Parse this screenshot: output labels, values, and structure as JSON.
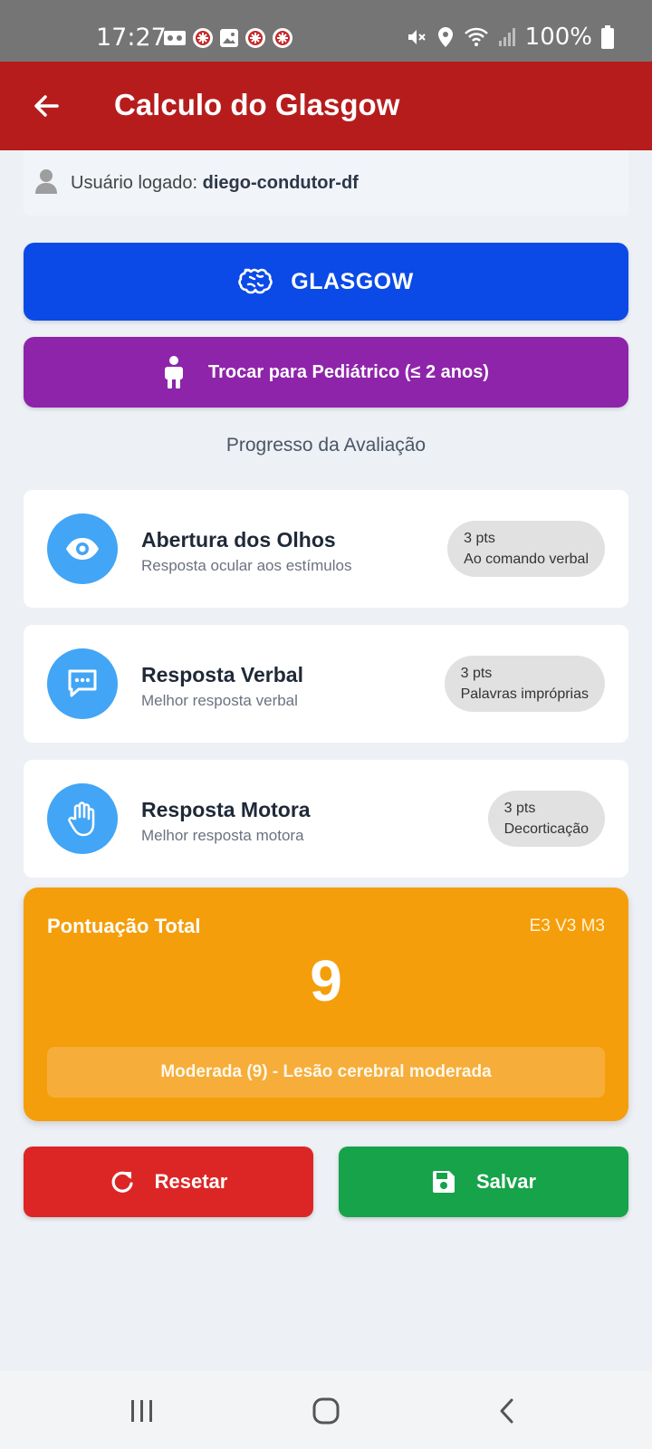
{
  "status_bar": {
    "time": "17:27",
    "battery": "100%",
    "left_icons": [
      "voicemail-icon",
      "app-notification-icon",
      "image-icon",
      "app-notification-icon",
      "app-notification-icon"
    ],
    "right_icons": [
      "mute-icon",
      "location-icon",
      "wifi-icon",
      "signal-icon",
      "battery-icon"
    ]
  },
  "app_bar": {
    "title": "Calculo do Glasgow",
    "color": "#b71c1c"
  },
  "user": {
    "prefix": "Usuário logado: ",
    "username": "diego-condutor-df"
  },
  "buttons": {
    "glasgow_label": "GLASGOW",
    "pediatric_label": "Trocar para Pediátrico (≤ 2 anos)"
  },
  "progress": {
    "title": "Progresso da Avaliação"
  },
  "criteria": [
    {
      "title": "Abertura dos Olhos",
      "subtitle": "Resposta ocular aos estímulos",
      "points": "3 pts",
      "response": "Ao comando verbal",
      "icon": "eye-icon"
    },
    {
      "title": "Resposta Verbal",
      "subtitle": "Melhor resposta verbal",
      "points": "3 pts",
      "response": "Palavras impróprias",
      "icon": "chat-icon"
    },
    {
      "title": "Resposta Motora",
      "subtitle": "Melhor resposta motora",
      "points": "3 pts",
      "response": "Decorticação",
      "icon": "hand-icon"
    }
  ],
  "total": {
    "label": "Pontuação Total",
    "breakdown": "E3 V3 M3",
    "value": "9",
    "classification": "Moderada (9) - Lesão cerebral moderada",
    "color": "#f59e0b"
  },
  "actions": {
    "reset_label": "Resetar",
    "save_label": "Salvar",
    "reset_color": "#dc2626",
    "save_color": "#16a34a"
  },
  "colors": {
    "glasgow_button": "#0b4ae6",
    "pediatric_button": "#8e24aa",
    "criteria_icon": "#42a5f5"
  }
}
